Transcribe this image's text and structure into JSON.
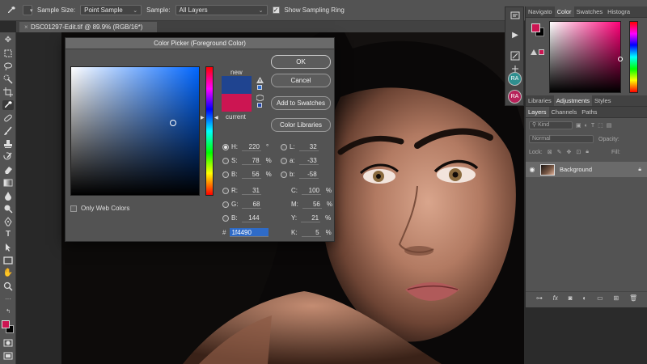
{
  "options_bar": {
    "sample_size_label": "Sample Size:",
    "sample_size_value": "Point Sample",
    "sample_label": "Sample:",
    "sample_value": "All Layers",
    "show_ring_label": "Show Sampling Ring",
    "show_ring_checked": true
  },
  "document": {
    "tab_title": "DSC01297-Edit.tif @ 89.9% (RGB/16*)"
  },
  "color_picker": {
    "title": "Color Picker (Foreground Color)",
    "new_label": "new",
    "current_label": "current",
    "new_color": "#1f4490",
    "current_color": "#cc1552",
    "buttons": {
      "ok": "OK",
      "cancel": "Cancel",
      "add_to_swatches": "Add to Swatches",
      "color_libraries": "Color Libraries"
    },
    "only_web_colors": "Only Web Colors",
    "fields": {
      "H": {
        "label": "H:",
        "value": "220",
        "unit": "°"
      },
      "S": {
        "label": "S:",
        "value": "78",
        "unit": "%"
      },
      "B": {
        "label": "B:",
        "value": "56",
        "unit": "%"
      },
      "R": {
        "label": "R:",
        "value": "31"
      },
      "G": {
        "label": "G:",
        "value": "68"
      },
      "Bl": {
        "label": "B:",
        "value": "144"
      },
      "L": {
        "label": "L:",
        "value": "32"
      },
      "a": {
        "label": "a:",
        "value": "-33"
      },
      "b": {
        "label": "b:",
        "value": "-58"
      },
      "C": {
        "label": "C:",
        "value": "100",
        "unit": "%"
      },
      "M": {
        "label": "M:",
        "value": "56",
        "unit": "%"
      },
      "Y": {
        "label": "Y:",
        "value": "21",
        "unit": "%"
      },
      "K": {
        "label": "K:",
        "value": "5",
        "unit": "%"
      }
    },
    "hex_label": "#",
    "hex_value": "1f4490"
  },
  "mini_panel": {
    "ra1": "RA",
    "ra2": "RA"
  },
  "right_panel": {
    "top_tabs": [
      "Navigato",
      "Color",
      "Swatches",
      "Histogra"
    ],
    "mid_tabs": [
      "Libraries",
      "Adjustments",
      "Styles"
    ],
    "layer_tabs": [
      "Layers",
      "Channels",
      "Paths"
    ],
    "kind_label": "Kind",
    "blend_mode": "Normal",
    "opacity_label": "Opacity:",
    "lock_label": "Lock:",
    "fill_label": "Fill:",
    "layer_name": "Background"
  },
  "colors": {
    "foreground": "#cc1552",
    "background": "#000000"
  }
}
